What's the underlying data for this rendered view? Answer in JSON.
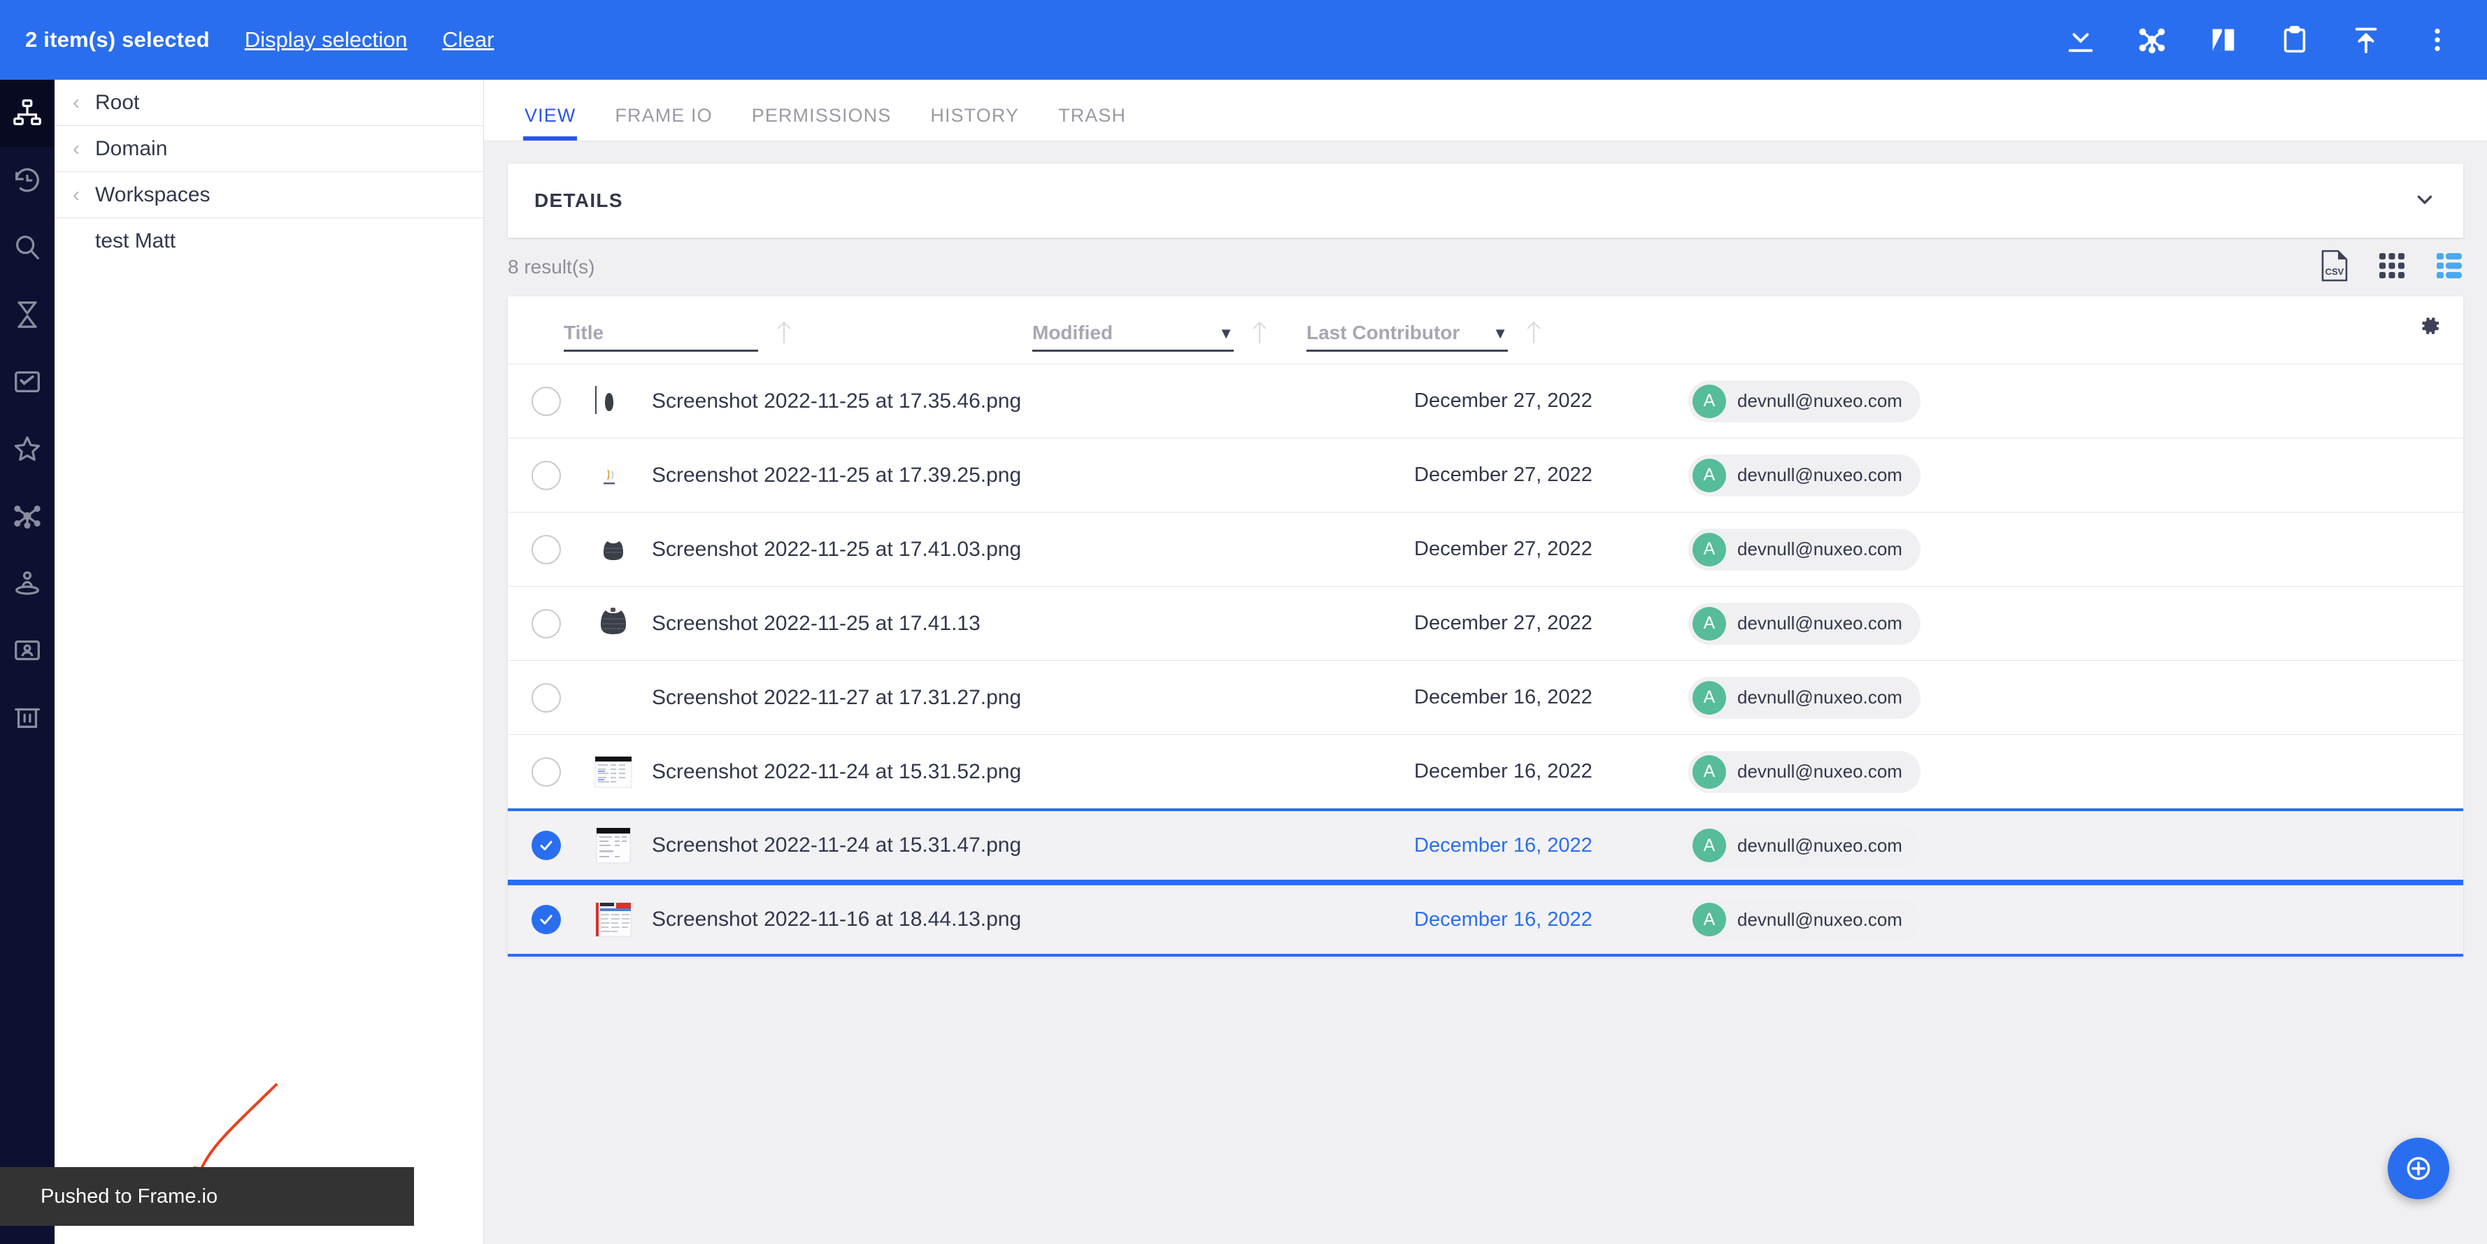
{
  "selection_bar": {
    "count_label": "2 item(s) selected",
    "display_selection_label": "Display selection",
    "clear_label": "Clear",
    "actions": [
      {
        "name": "download-icon",
        "tooltip": "Download"
      },
      {
        "name": "share-graph-icon",
        "tooltip": "Share"
      },
      {
        "name": "compare-icon",
        "tooltip": "Compare"
      },
      {
        "name": "clipboard-icon",
        "tooltip": "Clipboard"
      },
      {
        "name": "publish-upload-icon",
        "tooltip": "Publish"
      },
      {
        "name": "more-vertical-icon",
        "tooltip": "More"
      }
    ]
  },
  "rail": {
    "items": [
      {
        "name": "sitemap-icon",
        "label": "Browse",
        "active": true
      },
      {
        "name": "history-clock-icon",
        "label": "Recently viewed",
        "active": false
      },
      {
        "name": "search-icon",
        "label": "Search",
        "active": false
      },
      {
        "name": "hourglass-icon",
        "label": "Expired",
        "active": false
      },
      {
        "name": "tasks-icon",
        "label": "Tasks",
        "active": false
      },
      {
        "name": "star-icon",
        "label": "Favorites",
        "active": false
      },
      {
        "name": "collections-icon",
        "label": "Collections",
        "active": false
      },
      {
        "name": "user-location-icon",
        "label": "Personal space",
        "active": false
      },
      {
        "name": "id-card-icon",
        "label": "Profile",
        "active": false
      },
      {
        "name": "trash-icon",
        "label": "Trash",
        "active": false
      }
    ],
    "bottom": {
      "name": "org-chart-icon",
      "label": "Admin"
    }
  },
  "tree": {
    "nodes": [
      {
        "label": "Root",
        "expandable": true
      },
      {
        "label": "Domain",
        "expandable": true
      },
      {
        "label": "Workspaces",
        "expandable": true
      },
      {
        "label": "test Matt",
        "expandable": false
      }
    ]
  },
  "tabs": [
    {
      "label": "VIEW",
      "active": true
    },
    {
      "label": "FRAME IO",
      "active": false
    },
    {
      "label": "PERMISSIONS",
      "active": false
    },
    {
      "label": "HISTORY",
      "active": false
    },
    {
      "label": "TRASH",
      "active": false
    }
  ],
  "details": {
    "title": "DETAILS",
    "collapse_icon": "chevron-down-icon"
  },
  "results": {
    "count_label": "8 result(s)",
    "view_icons": [
      {
        "name": "csv-export-icon",
        "label": "CSV",
        "active": false
      },
      {
        "name": "grid-view-icon",
        "active": false
      },
      {
        "name": "list-view-icon",
        "active": true
      }
    ]
  },
  "table": {
    "columns": [
      {
        "key": "title",
        "placeholder": "Title",
        "has_caret": false,
        "sortable": true
      },
      {
        "key": "modified",
        "placeholder": "Modified",
        "has_caret": true,
        "sortable": true
      },
      {
        "key": "contributor",
        "placeholder": "Last Contributor",
        "has_caret": true,
        "sortable": true
      }
    ],
    "settings_icon": "gear-icon",
    "rows": [
      {
        "title": "Screenshot 2022-11-25 at 17.35.46.png",
        "modified": "December 27, 2022",
        "contributor": "devnull@nuxeo.com",
        "avatar_initial": "A",
        "selected": false,
        "thumb": "jacket-dark"
      },
      {
        "title": "Screenshot 2022-11-25 at 17.39.25.png",
        "modified": "December 27, 2022",
        "contributor": "devnull@nuxeo.com",
        "avatar_initial": "A",
        "selected": false,
        "thumb": "sketch-light"
      },
      {
        "title": "Screenshot 2022-11-25 at 17.41.03.png",
        "modified": "December 27, 2022",
        "contributor": "devnull@nuxeo.com",
        "avatar_initial": "A",
        "selected": false,
        "thumb": "jacket-dark"
      },
      {
        "title": "Screenshot 2022-11-25 at 17.41.13",
        "modified": "December 27, 2022",
        "contributor": "devnull@nuxeo.com",
        "avatar_initial": "A",
        "selected": false,
        "thumb": "jacket-dark-large"
      },
      {
        "title": "Screenshot 2022-11-27 at 17.31.27.png",
        "modified": "December 16, 2022",
        "contributor": "devnull@nuxeo.com",
        "avatar_initial": "A",
        "selected": false,
        "thumb": "none"
      },
      {
        "title": "Screenshot 2022-11-24 at 15.31.52.png",
        "modified": "December 16, 2022",
        "contributor": "devnull@nuxeo.com",
        "avatar_initial": "A",
        "selected": false,
        "thumb": "doc-table"
      },
      {
        "title": "Screenshot 2022-11-24 at 15.31.47.png",
        "modified": "December 16, 2022",
        "contributor": "devnull@nuxeo.com",
        "avatar_initial": "A",
        "selected": true,
        "thumb": "doc-table"
      },
      {
        "title": "Screenshot 2022-11-16 at 18.44.13.png",
        "modified": "December 16, 2022",
        "contributor": "devnull@nuxeo.com",
        "avatar_initial": "A",
        "selected": true,
        "thumb": "doc-red"
      }
    ]
  },
  "toast": {
    "message": "Pushed to Frame.io"
  },
  "fab": {
    "name": "add-circle-icon",
    "label": "Create"
  },
  "colors": {
    "primary_blue": "#2a6ef0",
    "tab_blue": "#2a55e8",
    "rail_bg": "#0d1030",
    "text_dark": "#32374c",
    "avatar_green": "#56bc9a",
    "toast_bg": "#333333",
    "annotation_red": "#e8411c",
    "page_bg": "#f0f0f2"
  }
}
